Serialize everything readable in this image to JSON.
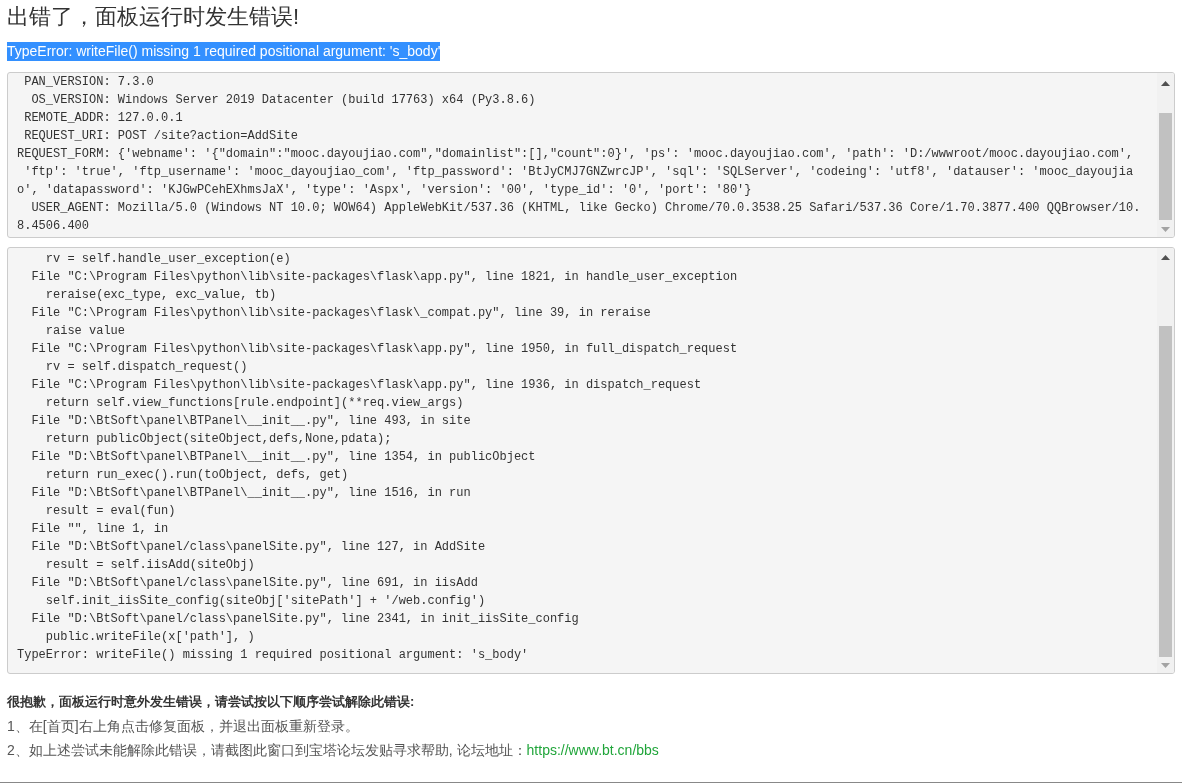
{
  "title": "出错了，面板运行时发生错误!",
  "error_message": {
    "text": "TypeError: writeFile() missing 1 required positional argument: 's_body'",
    "selected": true
  },
  "request_info": {
    "lines": [
      " PAN_VERSION: 7.3.0",
      "  OS_VERSION: Windows Server 2019 Datacenter (build 17763) x64 (Py3.8.6)",
      " REMOTE_ADDR: 127.0.0.1",
      " REQUEST_URI: POST /site?action=AddSite",
      "REQUEST_FORM: {'webname': '{\"domain\":\"mooc.dayoujiao.com\",\"domainlist\":[],\"count\":0}', 'ps': 'mooc.dayoujiao.com', 'path': 'D:/wwwroot/mooc.dayoujiao.com',",
      " 'ftp': 'true', 'ftp_username': 'mooc_dayoujiao_com', 'ftp_password': 'BtJyCMJ7GNZwrcJP', 'sql': 'SQLServer', 'codeing': 'utf8', 'datauser': 'mooc_dayoujia",
      "o', 'datapassword': 'KJGwPCehEXhmsJaX', 'type': 'Aspx', 'version': '00', 'type_id': '0', 'port': '80'}",
      "  USER_AGENT: Mozilla/5.0 (Windows NT 10.0; WOW64) AppleWebKit/537.36 (KHTML, like Gecko) Chrome/70.0.3538.25 Safari/537.36 Core/1.70.3877.400 QQBrowser/10.",
      "8.4506.400"
    ]
  },
  "traceback": {
    "lines": [
      "    rv = self.handle_user_exception(e)",
      "  File \"C:\\Program Files\\python\\lib\\site-packages\\flask\\app.py\", line 1821, in handle_user_exception",
      "    reraise(exc_type, exc_value, tb)",
      "  File \"C:\\Program Files\\python\\lib\\site-packages\\flask\\_compat.py\", line 39, in reraise",
      "    raise value",
      "  File \"C:\\Program Files\\python\\lib\\site-packages\\flask\\app.py\", line 1950, in full_dispatch_request",
      "    rv = self.dispatch_request()",
      "  File \"C:\\Program Files\\python\\lib\\site-packages\\flask\\app.py\", line 1936, in dispatch_request",
      "    return self.view_functions[rule.endpoint](**req.view_args)",
      "  File \"D:\\BtSoft\\panel\\BTPanel\\__init__.py\", line 493, in site",
      "    return publicObject(siteObject,defs,None,pdata);",
      "  File \"D:\\BtSoft\\panel\\BTPanel\\__init__.py\", line 1354, in publicObject",
      "    return run_exec().run(toObject, defs, get)",
      "  File \"D:\\BtSoft\\panel\\BTPanel\\__init__.py\", line 1516, in run",
      "    result = eval(fun)",
      "  File \"\", line 1, in",
      "  File \"D:\\BtSoft\\panel/class\\panelSite.py\", line 127, in AddSite",
      "    result = self.iisAdd(siteObj)",
      "  File \"D:\\BtSoft\\panel/class\\panelSite.py\", line 691, in iisAdd",
      "    self.init_iisSite_config(siteObj['sitePath'] + '/web.config')",
      "  File \"D:\\BtSoft\\panel/class\\panelSite.py\", line 2341, in init_iisSite_config",
      "    public.writeFile(x['path'], )",
      "TypeError: writeFile() missing 1 required positional argument: 's_body'"
    ]
  },
  "help": {
    "heading": "很抱歉，面板运行时意外发生错误，请尝试按以下顺序尝试解除此错误:",
    "steps": [
      {
        "text": "1、在[首页]右上角点击修复面板，并退出面板重新登录。"
      },
      {
        "text": "2、如上述尝试未能解除此错误，请截图此窗口到宝塔论坛发贴寻求帮助, 论坛地址：",
        "link": "https://www.bt.cn/bbs"
      }
    ]
  }
}
